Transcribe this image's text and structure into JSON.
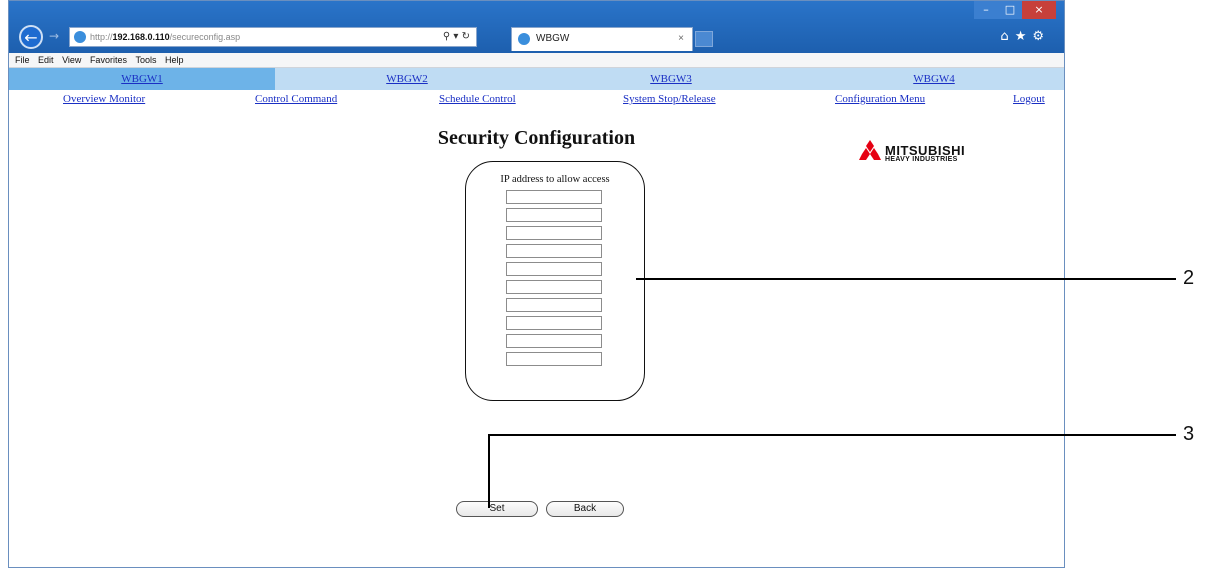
{
  "browser": {
    "address": {
      "prefix": "http://",
      "host": "192.168.0.110",
      "suffix": "/secureconfig.asp"
    },
    "tab_title": "WBGW",
    "menu": [
      "File",
      "Edit",
      "View",
      "Favorites",
      "Tools",
      "Help"
    ]
  },
  "gateway_tabs": [
    {
      "label": "WBGW1",
      "active": true
    },
    {
      "label": "WBGW2",
      "active": false
    },
    {
      "label": "WBGW3",
      "active": false
    },
    {
      "label": "WBGW4",
      "active": false
    }
  ],
  "nav": {
    "overview": "Overview Monitor",
    "control": "Control Command",
    "schedule": "Schedule Control",
    "stop_release": "System Stop/Release",
    "config": "Configuration Menu",
    "logout": "Logout"
  },
  "page": {
    "title": "Security Configuration",
    "logo_line1": "MITSUBISHI",
    "logo_line2": "HEAVY INDUSTRIES",
    "ip_label": "IP address to allow access",
    "ip_values": [
      "",
      "",
      "",
      "",
      "",
      "",
      "",
      "",
      "",
      ""
    ]
  },
  "buttons": {
    "set": "Set",
    "back": "Back"
  },
  "callouts": {
    "two": "2",
    "three": "3"
  },
  "colors": {
    "link": "#1a2fc4",
    "tab_bar": "#bfdcf3",
    "tab_active": "#6db3e8",
    "logo_red": "#e60012"
  }
}
